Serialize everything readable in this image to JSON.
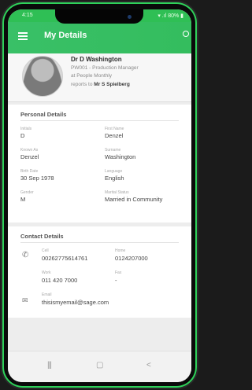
{
  "statusbar": {
    "time": "4:15",
    "right": "▾ .ıl 80% ▮"
  },
  "appbar": {
    "title": "My Details"
  },
  "profile": {
    "name": "Dr D Washington",
    "job_code": "PW001",
    "job_title": "Production Manager",
    "company_prefix": "at",
    "company": "People Monthly",
    "reports_prefix": "reports to",
    "manager": "Mr S Spielberg"
  },
  "personal": {
    "title": "Personal Details",
    "fields": [
      {
        "label": "Initials",
        "value": "D"
      },
      {
        "label": "First Name",
        "value": "Denzel"
      },
      {
        "label": "Known As",
        "value": "Denzel"
      },
      {
        "label": "Surname",
        "value": "Washington"
      },
      {
        "label": "Birth Date",
        "value": "30 Sep 1978"
      },
      {
        "label": "Language",
        "value": "English"
      },
      {
        "label": "Gender",
        "value": "M"
      },
      {
        "label": "Marital Status",
        "value": "Married in Community"
      }
    ]
  },
  "contact": {
    "title": "Contact Details",
    "cell_label": "Cell",
    "cell_value": "00262775614761",
    "home_label": "Home",
    "home_value": "0124207000",
    "work_label": "Work",
    "work_value": "011 420 7000",
    "fax_label": "Fax",
    "fax_value": "-",
    "email_label": "Email",
    "email_value": "thisismyemail@sage.com"
  },
  "navbar": {
    "recents": "|||",
    "home": "▢",
    "back": "<"
  },
  "colors": {
    "accent": "#34bd5e",
    "frame": "#2fd15a"
  }
}
